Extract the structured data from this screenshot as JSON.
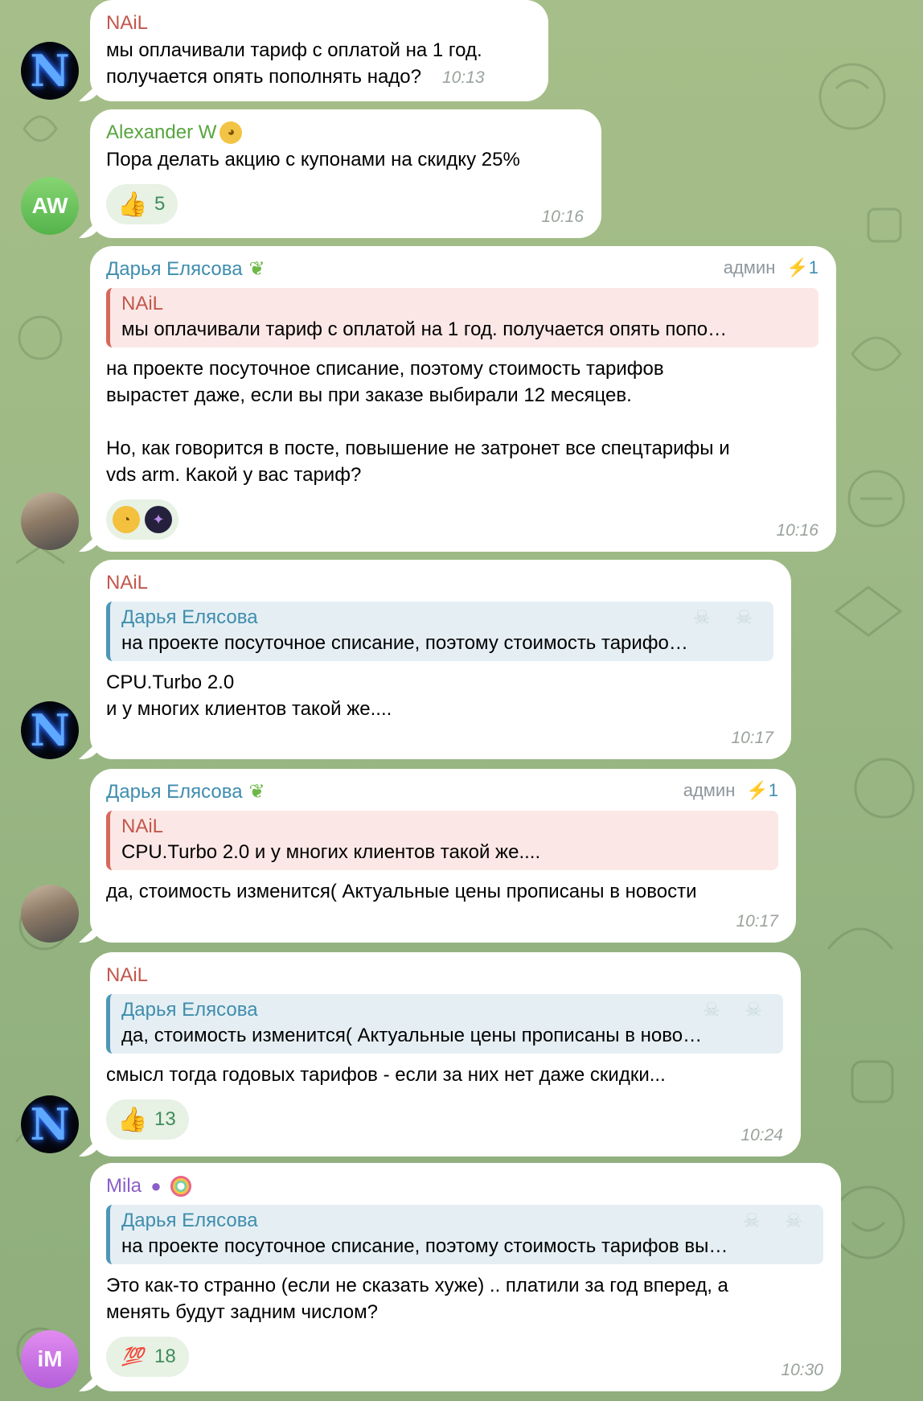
{
  "messages": [
    {
      "sender": "NAiL",
      "text": "мы оплачивали тариф с оплатой на 1 год.\nполучается опять пополнять надо?",
      "time": "10:13"
    },
    {
      "sender": "Alexander W",
      "text": "Пора делать акцию с купонами на скидку 25%",
      "reaction_count": "5",
      "time": "10:16",
      "avatar_initials": "AW"
    },
    {
      "sender": "Дарья Елясова",
      "role": "админ",
      "boost": "1",
      "quote_name": "NAiL",
      "quote_text": "мы оплачивали тариф с оплатой на 1 год. получается опять попо…",
      "text": "на проекте посуточное списание, поэтому стоимость тарифов\nвырастет даже, если вы при заказе выбирали 12 месяцев.\n\nНо, как говорится в посте, повышение не затронет все спецтарифы и\nvds arm. Какой у вас тариф?",
      "time": "10:16"
    },
    {
      "sender": "NAiL",
      "quote_name": "Дарья Елясова",
      "quote_text": "на проекте посуточное списание, поэтому стоимость тарифо…",
      "text": "CPU.Turbo 2.0\nи у многих клиентов такой же....",
      "time": "10:17"
    },
    {
      "sender": "Дарья Елясова",
      "role": "админ",
      "boost": "1",
      "quote_name": "NAiL",
      "quote_text": "CPU.Turbo 2.0 и у многих клиентов такой же....",
      "text": "да, стоимость изменится( Актуальные цены прописаны в новости",
      "time": "10:17"
    },
    {
      "sender": "NAiL",
      "quote_name": "Дарья Елясова",
      "quote_text": "да, стоимость изменится( Актуальные цены прописаны в ново…",
      "text": "смысл тогда годовых тарифов - если за них нет даже скидки...",
      "reaction_count": "13",
      "time": "10:24"
    },
    {
      "sender": "Mila",
      "quote_name": "Дарья Елясова",
      "quote_text": "на проекте посуточное списание, поэтому стоимость тарифов вы…",
      "text": "Это как-то странно (если не сказать хуже) .. платили за год вперед, а\nменять будут задним числом?",
      "reaction_count": "18",
      "time": "10:30",
      "avatar_initials": "iM"
    }
  ],
  "icons": {
    "thumbs_up": "thumbs-up-icon",
    "hundred": "hundred-points-icon",
    "bolt": "lightning-icon"
  },
  "colors": {
    "nail": "#c2574b",
    "alexander": "#57a53e",
    "darya": "#3f8dae",
    "mila": "#8b5ec9",
    "reaction_text": "#3f8d5a"
  }
}
